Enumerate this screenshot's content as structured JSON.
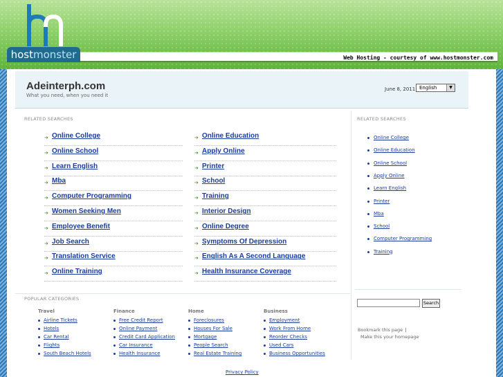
{
  "banner": {
    "logo_letters": "hm",
    "brand_part1": "host",
    "brand_part2": "monster",
    "courtesy": "Web Hosting - courtesy of www.hostmonster.com"
  },
  "header": {
    "site_title": "Adeinterph.com",
    "tagline": "What you need, when you need it",
    "date": "June 8, 2011",
    "language": "English"
  },
  "related_label": "RELATED SEARCHES",
  "results_left": [
    "Online College",
    "Online School",
    "Learn English",
    "Mba",
    "Computer Programming",
    "Women Seeking Men",
    "Employee Benefit",
    "Job Search",
    "Translation Service",
    "Online Training"
  ],
  "results_right": [
    "Online Education",
    "Apply Online",
    "Printer",
    "School",
    "Training",
    "Interior Design",
    "Online Degree",
    "Symptoms Of Depression",
    "English As A Second Language",
    "Health Insurance Coverage"
  ],
  "sidebar": {
    "label": "RELATED SEARCHES",
    "items": [
      "Online College",
      "Online Education",
      "Online School",
      "Apply Online",
      "Learn English",
      "Printer",
      "Mba",
      "School",
      "Computer Programming",
      "Training"
    ],
    "search_button": "Search",
    "bookmark": "Bookmark this page",
    "homepage": "Make this your homepage"
  },
  "popular": {
    "label": "POPULAR CATEGORIES",
    "categories": [
      {
        "heading": "Travel",
        "items": [
          "Airline Tickets",
          "Hotels",
          "Car Rental",
          "Flights",
          "South Beach Hotels"
        ]
      },
      {
        "heading": "Finance",
        "items": [
          "Free Credit Report",
          "Online Payment",
          "Credit Card Application",
          "Car Insurance",
          "Health Insurance"
        ]
      },
      {
        "heading": "Home",
        "items": [
          "Foreclosures",
          "Houses For Sale",
          "Mortgage",
          "People Search",
          "Real Estate Training"
        ]
      },
      {
        "heading": "Business",
        "items": [
          "Employment",
          "Work From Home",
          "Reorder Checks",
          "Used Cars",
          "Business Opportunities"
        ]
      }
    ]
  },
  "footer": {
    "privacy": "Privacy Policy"
  }
}
